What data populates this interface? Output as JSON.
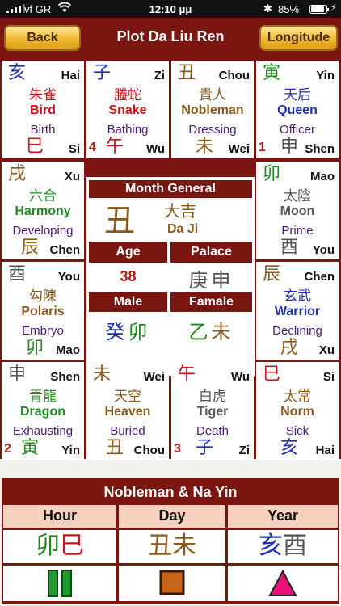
{
  "status_bar": {
    "carrier": "vf GR",
    "time": "12:10 μμ",
    "battery": "85%"
  },
  "nav": {
    "back_label": "Back",
    "title": "Plot Da Liu Ren",
    "longitude_label": "Longitude"
  },
  "colors": {
    "maroon": "#7b1510",
    "gold": "#f0b92f",
    "red": "#c9141a",
    "green": "#1f8a1f",
    "blue": "#1f2fb0",
    "brown": "#8a5a1e",
    "purple": "#4a1b7a"
  },
  "cells": [
    {
      "top_char": "亥",
      "top_py": "Hai",
      "god_cn": "朱雀",
      "god_en": "Bird",
      "state": "Birth",
      "bottom_char": "巳",
      "bottom_py": "Si",
      "num": ""
    },
    {
      "top_char": "子",
      "top_py": "Zi",
      "god_cn": "螣蛇",
      "god_en": "Snake",
      "state": "Bathing",
      "bottom_char": "午",
      "bottom_py": "Wu",
      "num": "4"
    },
    {
      "top_char": "丑",
      "top_py": "Chou",
      "god_cn": "貴人",
      "god_en": "Nobleman",
      "state": "Dressing",
      "bottom_char": "未",
      "bottom_py": "Wei",
      "num": ""
    },
    {
      "top_char": "寅",
      "top_py": "Yin",
      "god_cn": "天后",
      "god_en": "Queen",
      "state": "Officer",
      "bottom_char": "申",
      "bottom_py": "Shen",
      "num": "1"
    },
    {
      "top_char": "戌",
      "top_py": "Xu",
      "god_cn": "六合",
      "god_en": "Harmony",
      "state": "Developing",
      "bottom_char": "辰",
      "bottom_py": "Chen",
      "num": ""
    },
    {
      "top_char": "卯",
      "top_py": "Mao",
      "god_cn": "太陰",
      "god_en": "Moon",
      "state": "Prime",
      "bottom_char": "酉",
      "bottom_py": "You",
      "num": ""
    },
    {
      "top_char": "酉",
      "top_py": "You",
      "god_cn": "勾陳",
      "god_en": "Polaris",
      "state": "Embryo",
      "bottom_char": "卯",
      "bottom_py": "Mao",
      "num": ""
    },
    {
      "top_char": "辰",
      "top_py": "Chen",
      "god_cn": "玄武",
      "god_en": "Warrior",
      "state": "Declining",
      "bottom_char": "戌",
      "bottom_py": "Xu",
      "num": ""
    },
    {
      "top_char": "申",
      "top_py": "Shen",
      "god_cn": "青龍",
      "god_en": "Dragon",
      "state": "Exhausting",
      "bottom_char": "寅",
      "bottom_py": "Yin",
      "num": "2"
    },
    {
      "top_char": "未",
      "top_py": "Wei",
      "god_cn": "天空",
      "god_en": "Heaven",
      "state": "Buried",
      "bottom_char": "丑",
      "bottom_py": "Chou",
      "num": ""
    },
    {
      "top_char": "午",
      "top_py": "Wu",
      "god_cn": "白虎",
      "god_en": "Tiger",
      "state": "Death",
      "bottom_char": "子",
      "bottom_py": "Zi",
      "num": "3"
    },
    {
      "top_char": "巳",
      "top_py": "Si",
      "god_cn": "太常",
      "god_en": "Norm",
      "state": "Sick",
      "bottom_char": "亥",
      "bottom_py": "Hai",
      "num": ""
    }
  ],
  "center": {
    "month_general_label": "Month General",
    "month_general_char": "丑",
    "month_general_cn": "大吉",
    "month_general_py": "Da Ji",
    "age_label": "Age",
    "age_value": "38",
    "palace_label": "Palace",
    "palace_value": "庚申",
    "male_label": "Male",
    "male_value": "癸卯",
    "female_label": "Famale",
    "female_value": "乙未"
  },
  "nayin": {
    "title": "Nobleman & Na Yin",
    "columns": [
      {
        "label": "Hour",
        "char1": "卯",
        "char2": "巳",
        "symbol": "pause-bars-icon"
      },
      {
        "label": "Day",
        "char1": "丑",
        "char2": "未",
        "symbol": "square-icon"
      },
      {
        "label": "Year",
        "char1": "亥",
        "char2": "酉",
        "symbol": "triangle-icon"
      }
    ]
  }
}
